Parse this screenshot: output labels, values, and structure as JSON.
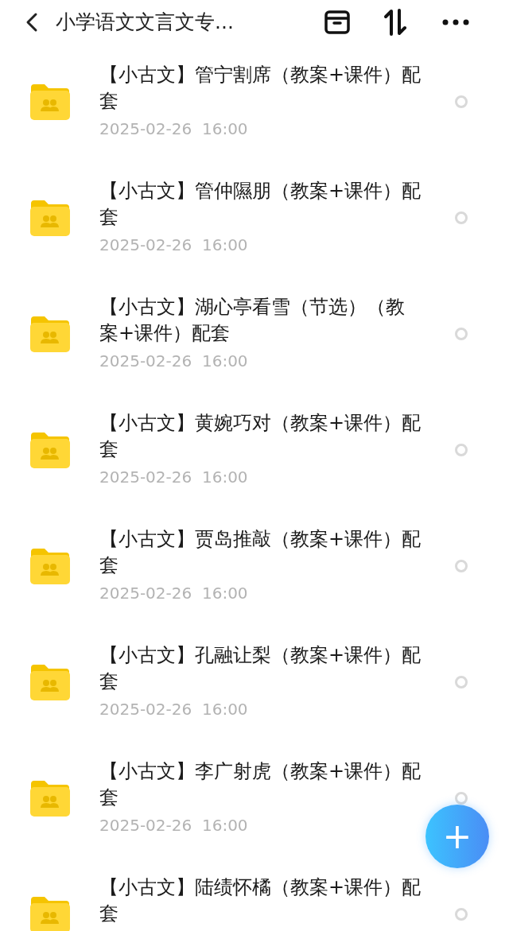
{
  "header": {
    "title": "小学语文文言文专..."
  },
  "files": [
    {
      "title": "【小古文】管宁割席（教案+课件）配套",
      "date": "2025-02-26  16:00",
      "selected": false
    },
    {
      "title": "【小古文】管仲隰朋（教案+课件）配套",
      "date": "2025-02-26  16:00",
      "selected": false
    },
    {
      "title": "【小古文】湖心亭看雪（节选）（教案+课件）配套",
      "date": "2025-02-26  16:00",
      "selected": false
    },
    {
      "title": "【小古文】黄婉巧对（教案+课件）配套",
      "date": "2025-02-26  16:00",
      "selected": false
    },
    {
      "title": "【小古文】贾岛推敲（教案+课件）配套",
      "date": "2025-02-26  16:00",
      "selected": false
    },
    {
      "title": "【小古文】孔融让梨（教案+课件）配套",
      "date": "2025-02-26  16:00",
      "selected": false
    },
    {
      "title": "【小古文】李广射虎（教案+课件）配套",
      "date": "2025-02-26  16:00",
      "selected": false
    },
    {
      "title": "【小古文】陆绩怀橘（教案+课件）配套",
      "selected": false
    }
  ],
  "fab": {
    "label": "+"
  }
}
